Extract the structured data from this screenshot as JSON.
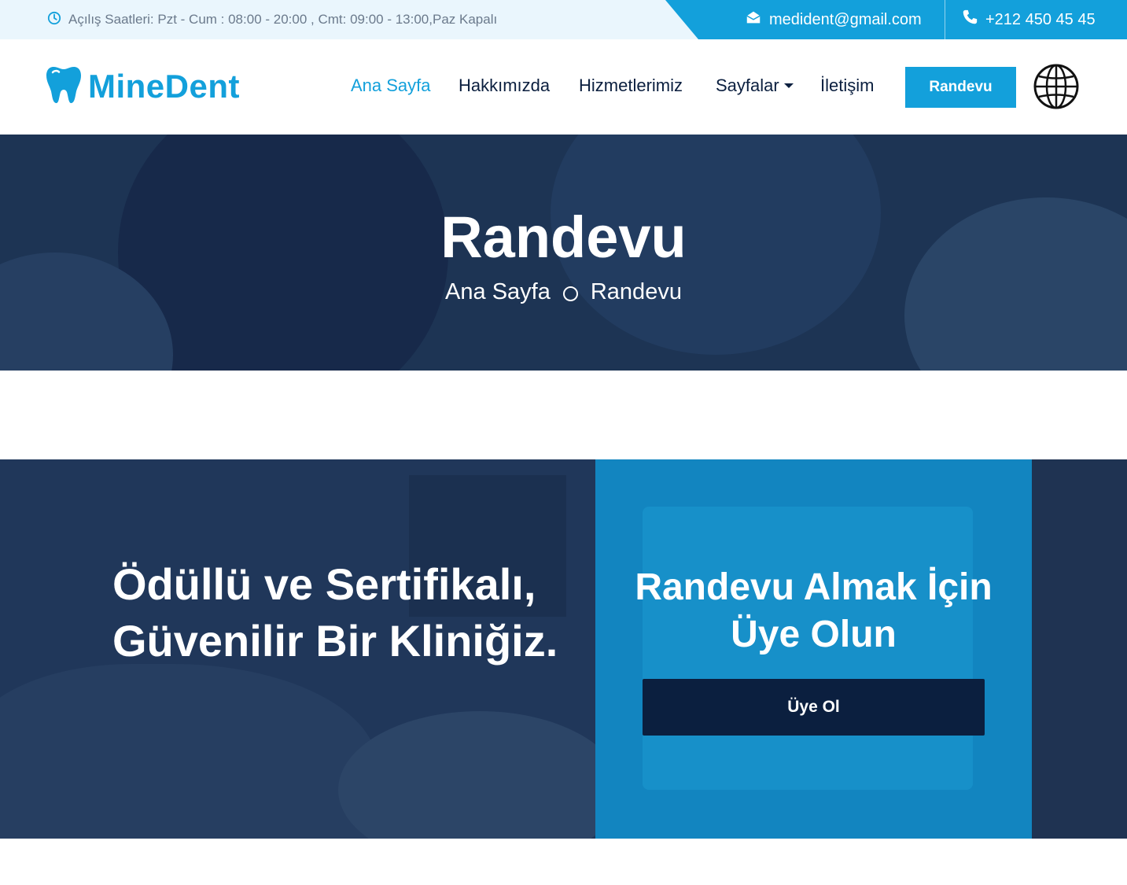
{
  "topbar": {
    "hours": "Açılış Saatleri: Pzt - Cum : 08:00 - 20:00 , Cmt: 09:00 - 13:00,Paz Kapalı",
    "email": "medident@gmail.com",
    "phone": "+212 450 45 45"
  },
  "brand": {
    "name": "MineDent"
  },
  "nav": {
    "items": [
      {
        "label": "Ana Sayfa",
        "active": true
      },
      {
        "label": "Hakkımızda"
      },
      {
        "label": "Hizmetlerimiz"
      },
      {
        "label": "Sayfalar",
        "dropdown": true
      },
      {
        "label": "İletişim"
      }
    ],
    "cta": "Randevu"
  },
  "hero": {
    "title": "Randevu",
    "breadcrumb": [
      "Ana Sayfa",
      "Randevu"
    ]
  },
  "promo": {
    "heading": "Ödüllü ve Sertifikalı, Güvenilir Bir Kliniğiz.",
    "signup_title": "Randevu Almak İçin Üye Olun",
    "signup_button": "Üye Ol"
  },
  "colors": {
    "accent": "#13a0db",
    "navy": "#0b1f3f",
    "hero_overlay": "#1d3454",
    "promo_blue": "#1285c0"
  },
  "icons": [
    "clock-icon",
    "envelope-icon",
    "phone-icon",
    "tooth-icon",
    "globe-icon",
    "chevron-down-icon",
    "circle-separator-icon"
  ]
}
